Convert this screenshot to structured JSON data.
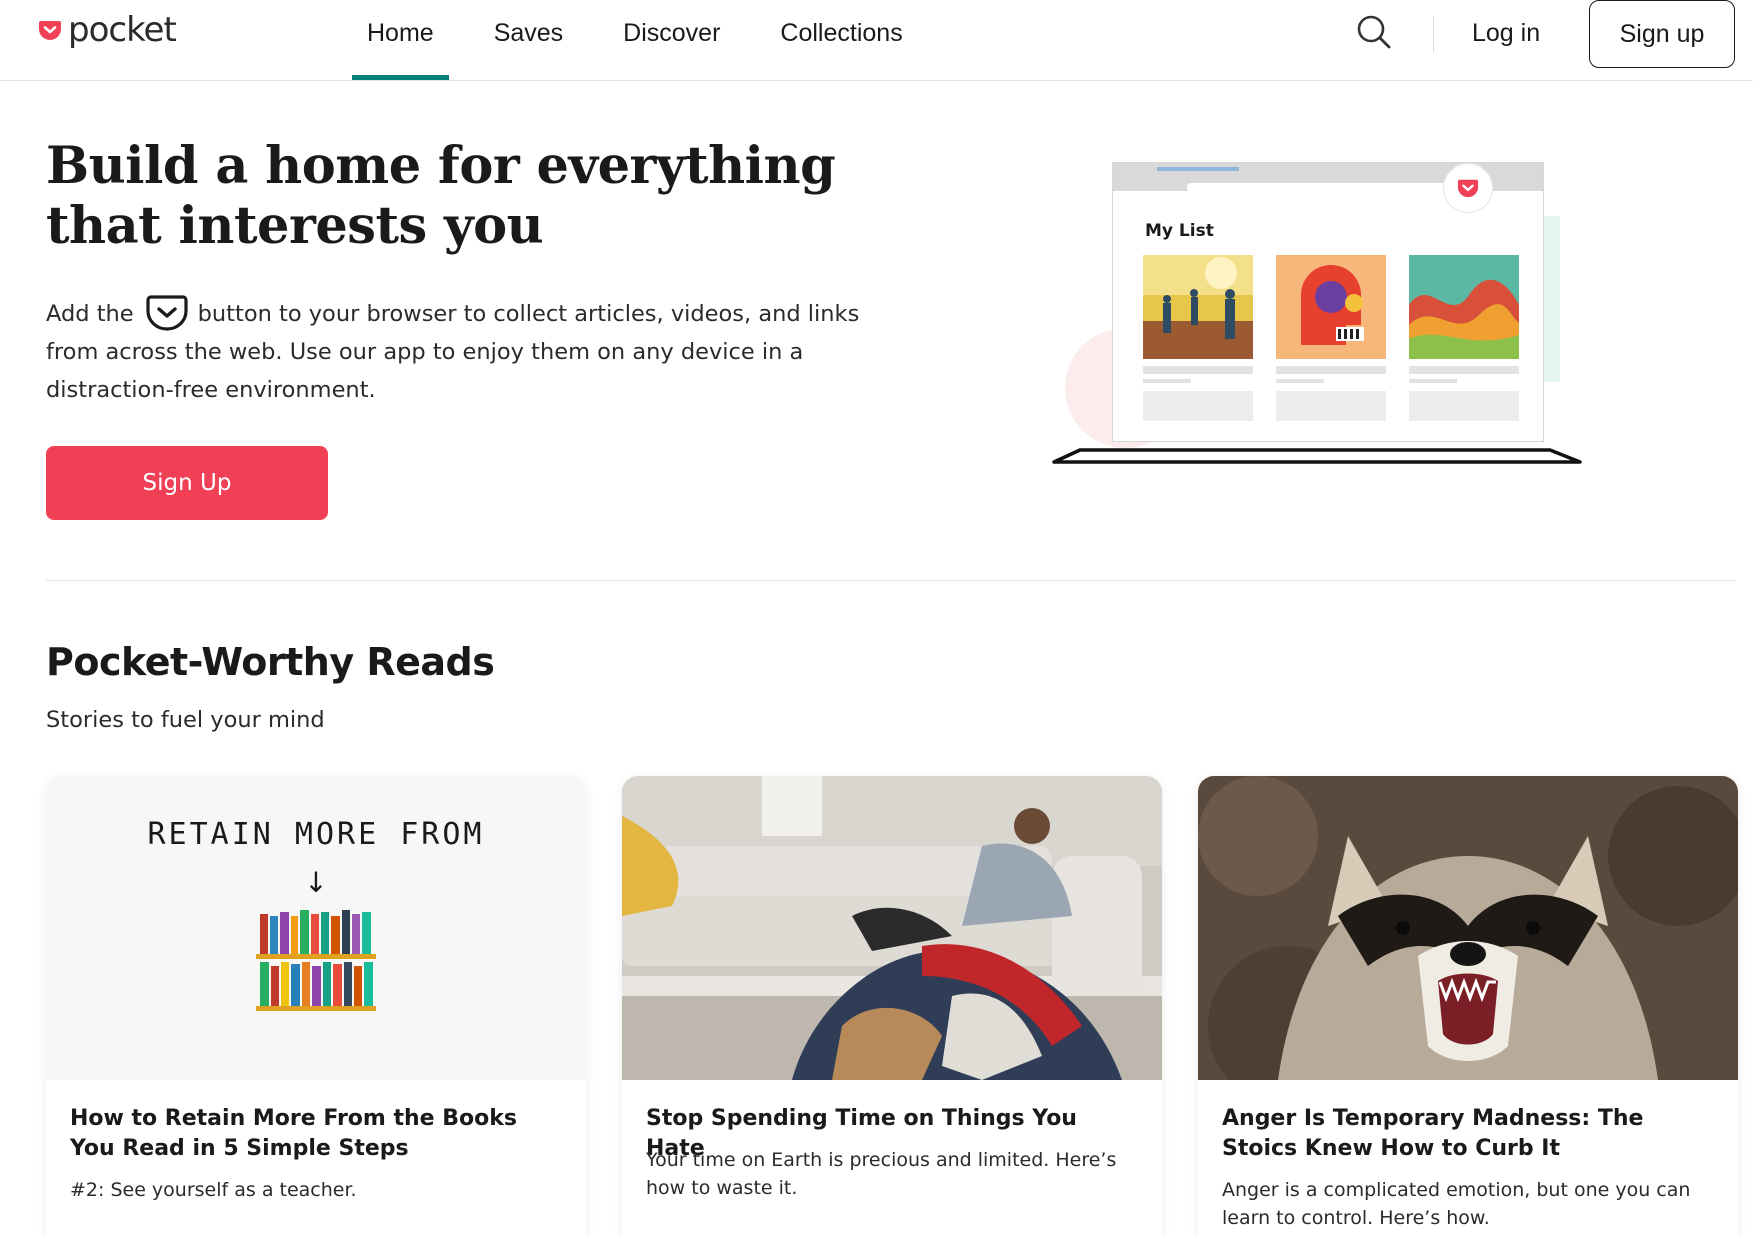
{
  "header": {
    "logo_text": "pocket",
    "nav": [
      {
        "label": "Home",
        "active": true
      },
      {
        "label": "Saves",
        "active": false
      },
      {
        "label": "Discover",
        "active": false
      },
      {
        "label": "Collections",
        "active": false
      }
    ],
    "search_icon": "search-icon",
    "login_label": "Log in",
    "signup_label": "Sign up"
  },
  "hero": {
    "title": "Build a home for everything that interests you",
    "description_before": "Add the",
    "description_after": "button to your browser to collect articles, videos, and links from across the web. Use our app to enjoy them on any device in a distraction-free environment.",
    "cta_label": "Sign Up",
    "illustration": {
      "heading": "My List"
    }
  },
  "section": {
    "title": "Pocket-Worthy Reads",
    "subtitle": "Stories to fuel your mind",
    "cards": [
      {
        "image_text": "RETAIN MORE FROM",
        "title": "How to Retain More From the Books You Read in 5 Simple Steps",
        "excerpt": "#2: See yourself as a teacher."
      },
      {
        "title": "Stop Spending Time on Things You Hate",
        "excerpt": "Your time on Earth is precious and limited. Here’s how to waste it."
      },
      {
        "title": "Anger Is Temporary Madness: The Stoics Knew How to Curb It",
        "excerpt": "Anger is a complicated emotion, but one you can learn to control. Here’s how."
      }
    ]
  },
  "colors": {
    "brand_red": "#ef4056",
    "active_teal": "#008078",
    "text": "#1a1a1a"
  }
}
